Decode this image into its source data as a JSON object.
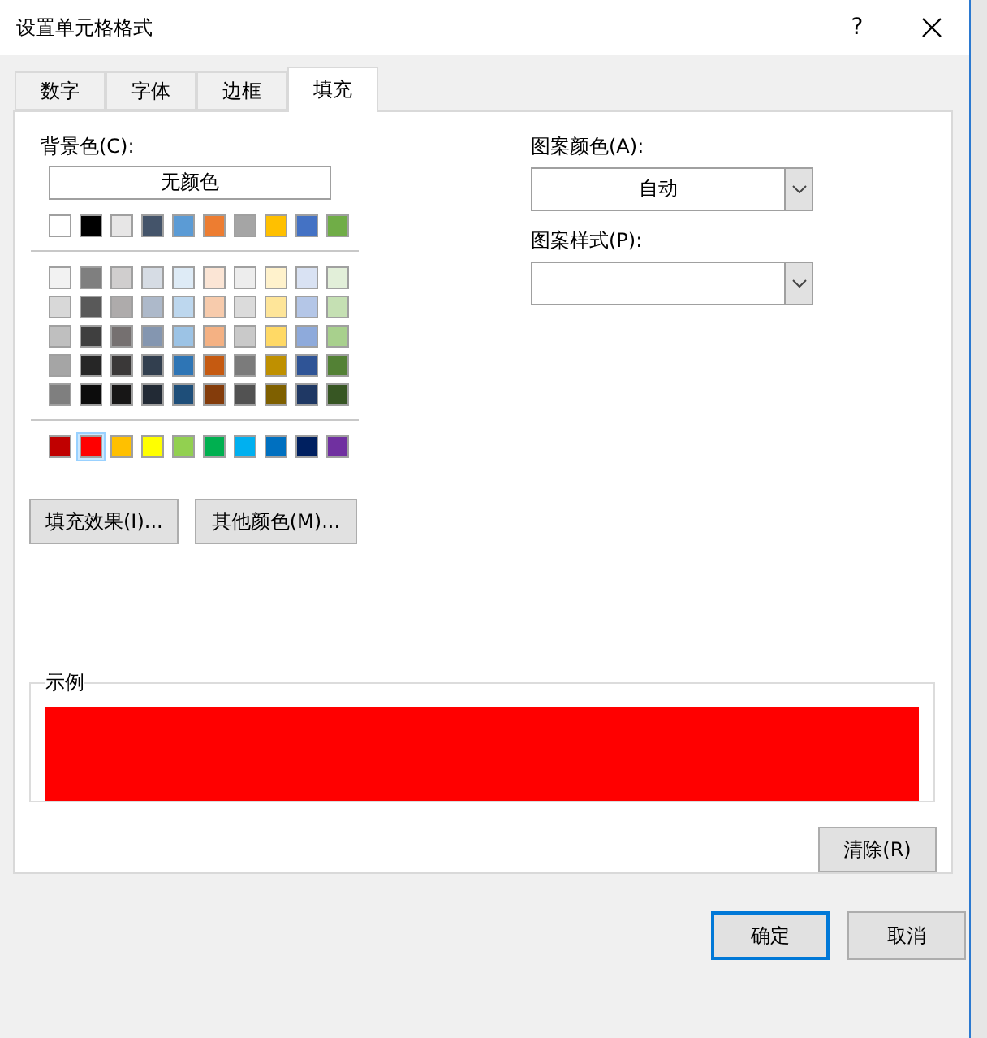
{
  "window": {
    "title": "设置单元格格式",
    "help": "?"
  },
  "tabs": [
    {
      "label": "数字",
      "selected": false
    },
    {
      "label": "字体",
      "selected": false
    },
    {
      "label": "边框",
      "selected": false
    },
    {
      "label": "填充",
      "selected": true
    }
  ],
  "background": {
    "label": "背景色(C):",
    "no_color": "无颜色",
    "swatch_groups": [
      [
        [
          {
            "color": "#ffffff",
            "selected": false
          },
          {
            "color": "#000000",
            "selected": false
          },
          {
            "color": "#e7e6e6",
            "selected": false
          },
          {
            "color": "#44546a",
            "selected": false
          },
          {
            "color": "#5b9bd5",
            "selected": false
          },
          {
            "color": "#ed7d31",
            "selected": false
          },
          {
            "color": "#a5a5a5",
            "selected": false
          },
          {
            "color": "#ffc000",
            "selected": false
          },
          {
            "color": "#4472c4",
            "selected": false
          },
          {
            "color": "#70ad47",
            "selected": false
          }
        ]
      ],
      [
        [
          {
            "color": "#f2f2f2",
            "selected": false
          },
          {
            "color": "#7f7f7f",
            "selected": false
          },
          {
            "color": "#d0cece",
            "selected": false
          },
          {
            "color": "#d6dce4",
            "selected": false
          },
          {
            "color": "#deebf6",
            "selected": false
          },
          {
            "color": "#fbe5d5",
            "selected": false
          },
          {
            "color": "#ededed",
            "selected": false
          },
          {
            "color": "#fff2cc",
            "selected": false
          },
          {
            "color": "#d9e2f3",
            "selected": false
          },
          {
            "color": "#e2efd9",
            "selected": false
          }
        ],
        [
          {
            "color": "#d8d8d8",
            "selected": false
          },
          {
            "color": "#595959",
            "selected": false
          },
          {
            "color": "#aeabab",
            "selected": false
          },
          {
            "color": "#adb9ca",
            "selected": false
          },
          {
            "color": "#bdd7ee",
            "selected": false
          },
          {
            "color": "#f7cbac",
            "selected": false
          },
          {
            "color": "#dbdbdb",
            "selected": false
          },
          {
            "color": "#fee599",
            "selected": false
          },
          {
            "color": "#b4c6e7",
            "selected": false
          },
          {
            "color": "#c5e0b3",
            "selected": false
          }
        ],
        [
          {
            "color": "#bfbfbf",
            "selected": false
          },
          {
            "color": "#3f3f3f",
            "selected": false
          },
          {
            "color": "#757070",
            "selected": false
          },
          {
            "color": "#8496b0",
            "selected": false
          },
          {
            "color": "#9cc3e5",
            "selected": false
          },
          {
            "color": "#f4b183",
            "selected": false
          },
          {
            "color": "#c9c9c9",
            "selected": false
          },
          {
            "color": "#ffd965",
            "selected": false
          },
          {
            "color": "#8eaadb",
            "selected": false
          },
          {
            "color": "#a8d08d",
            "selected": false
          }
        ],
        [
          {
            "color": "#a5a5a5",
            "selected": false
          },
          {
            "color": "#262626",
            "selected": false
          },
          {
            "color": "#3a3838",
            "selected": false
          },
          {
            "color": "#323f4f",
            "selected": false
          },
          {
            "color": "#2e75b5",
            "selected": false
          },
          {
            "color": "#c55a11",
            "selected": false
          },
          {
            "color": "#7b7b7b",
            "selected": false
          },
          {
            "color": "#bf9000",
            "selected": false
          },
          {
            "color": "#2f5496",
            "selected": false
          },
          {
            "color": "#538135",
            "selected": false
          }
        ],
        [
          {
            "color": "#7f7f7f",
            "selected": false
          },
          {
            "color": "#0c0c0c",
            "selected": false
          },
          {
            "color": "#171616",
            "selected": false
          },
          {
            "color": "#222a35",
            "selected": false
          },
          {
            "color": "#1e4e79",
            "selected": false
          },
          {
            "color": "#843c0b",
            "selected": false
          },
          {
            "color": "#525252",
            "selected": false
          },
          {
            "color": "#7f6000",
            "selected": false
          },
          {
            "color": "#1f3864",
            "selected": false
          },
          {
            "color": "#375623",
            "selected": false
          }
        ]
      ],
      [
        [
          {
            "color": "#c00000",
            "selected": false
          },
          {
            "color": "#ff0000",
            "selected": true
          },
          {
            "color": "#ffc000",
            "selected": false
          },
          {
            "color": "#ffff00",
            "selected": false
          },
          {
            "color": "#92d050",
            "selected": false
          },
          {
            "color": "#00b050",
            "selected": false
          },
          {
            "color": "#00b0f0",
            "selected": false
          },
          {
            "color": "#0070c0",
            "selected": false
          },
          {
            "color": "#002060",
            "selected": false
          },
          {
            "color": "#7030a0",
            "selected": false
          }
        ]
      ]
    ],
    "buttons": [
      "填充效果(I)...",
      "其他颜色(M)..."
    ]
  },
  "pattern_color": {
    "label": "图案颜色(A):",
    "value": "自动"
  },
  "pattern_style": {
    "label": "图案样式(P):"
  },
  "sample": {
    "label": "示例",
    "color": "#ff0000"
  },
  "clear_button": "清除(R)",
  "footer_buttons": [
    {
      "label": "确定",
      "focused": true
    },
    {
      "label": "取消",
      "focused": false
    }
  ]
}
